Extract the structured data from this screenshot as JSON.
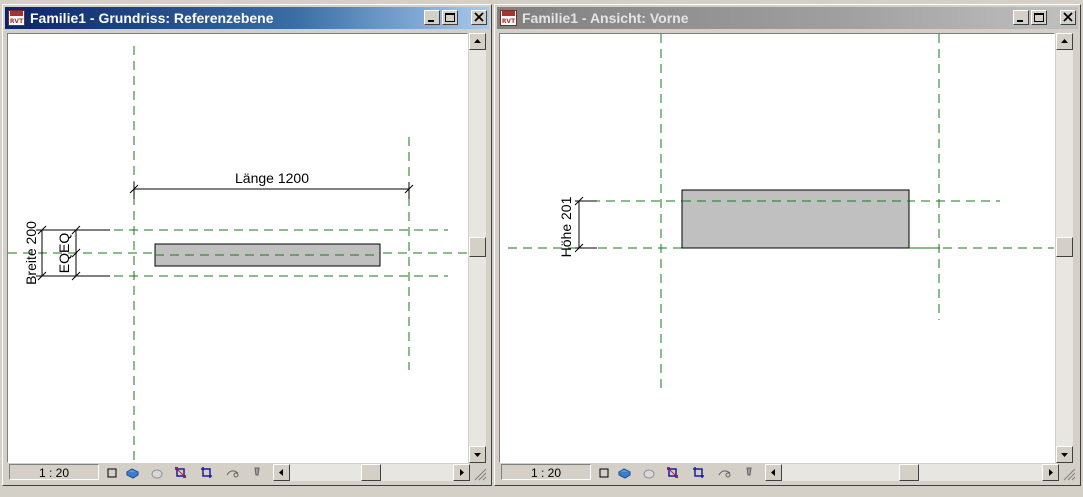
{
  "left_window": {
    "app_icon_label": "RVT",
    "title": "Familie1 - Grundriss: Referenzebene",
    "dim_length": "Länge 1200",
    "dim_width": "Breite 200",
    "dim_eq": "EQEQ",
    "scale": "1 : 20"
  },
  "right_window": {
    "app_icon_label": "RVT",
    "title": "Familie1 - Ansicht: Vorne",
    "dim_height": "Höhe 201",
    "scale": "1 : 20"
  },
  "colors": {
    "reference_plane": "#1a7a1a",
    "element_fill": "#c0c0c0",
    "active_title": "#0a246a",
    "inactive_title": "#808080"
  },
  "icons": [
    "minimize-icon",
    "maximize-icon",
    "close-icon",
    "detail-level-icon",
    "model-graphics-icon",
    "shadows-icon",
    "crop-view-icon",
    "show-crop-icon",
    "temporary-hide-icon",
    "reveal-hidden-icon"
  ]
}
